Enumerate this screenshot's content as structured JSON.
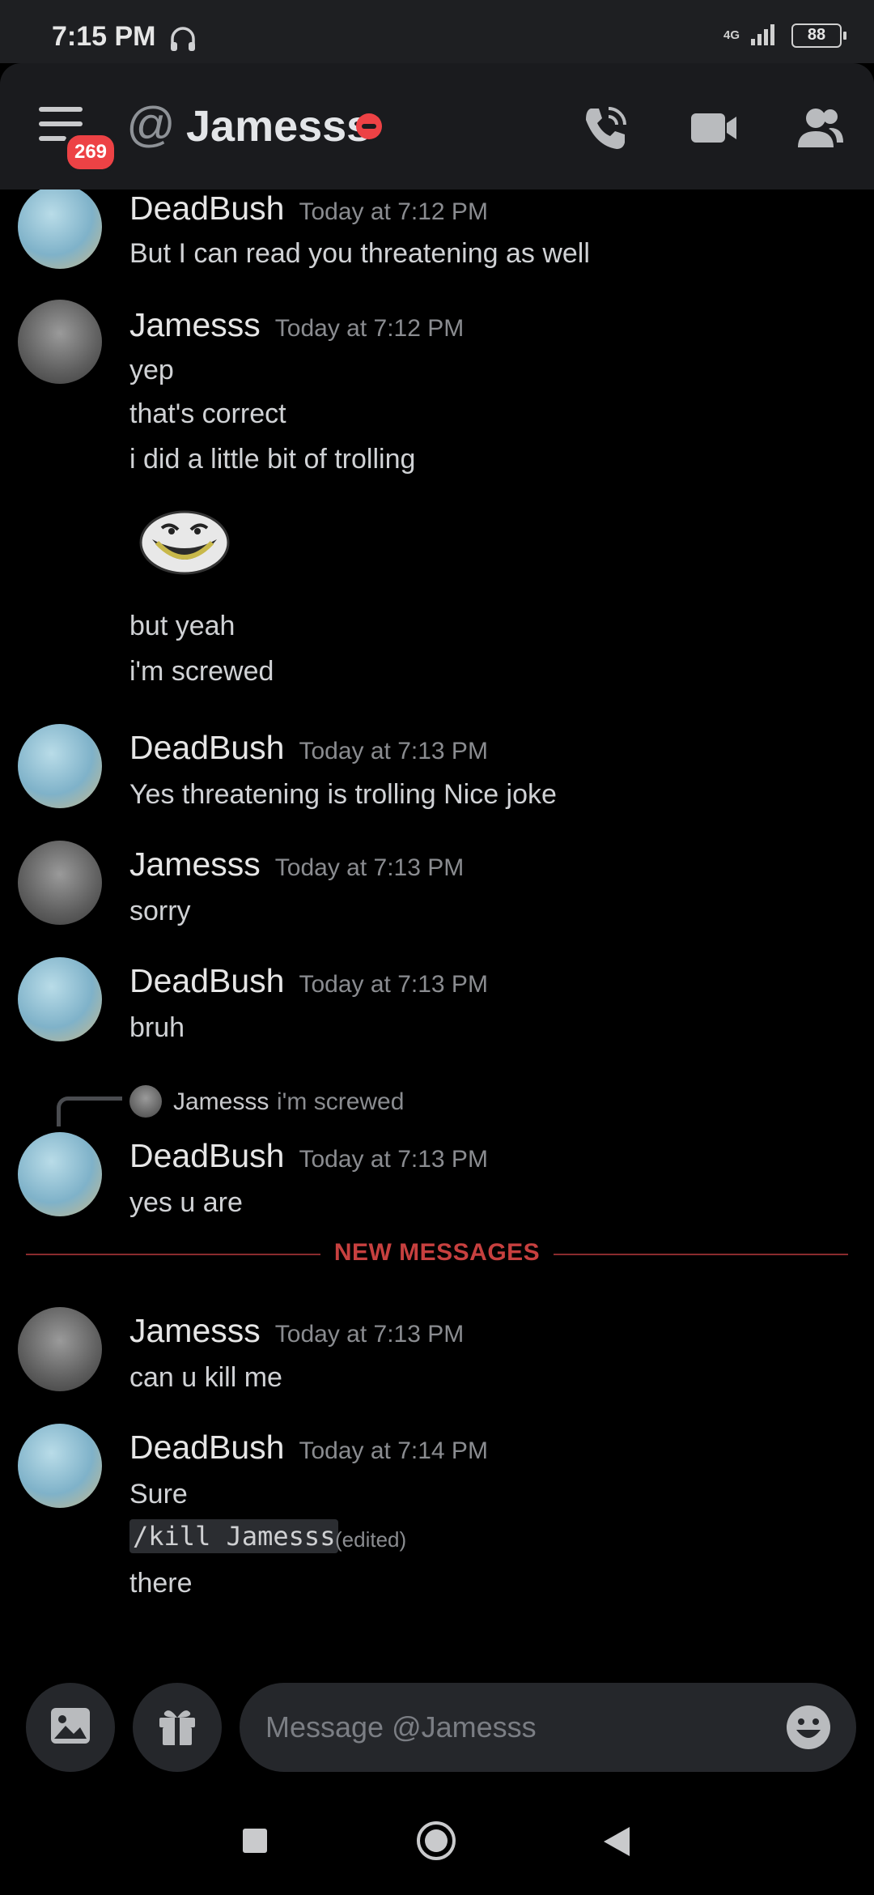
{
  "status_bar": {
    "time": "7:15 PM",
    "network": "4G",
    "battery": "88"
  },
  "header": {
    "notification_count": "269",
    "at_symbol": "@",
    "channel_name": "Jamesss"
  },
  "messages": [
    {
      "author": "DeadBush",
      "timestamp": "Today at 7:12 PM",
      "lines": [
        "But I can read you threatening as well"
      ]
    },
    {
      "author": "Jamesss",
      "timestamp": "Today at 7:12 PM",
      "lines": [
        "yep",
        "that's correct",
        "i did a little bit of trolling",
        "but yeah",
        "i'm screwed"
      ]
    },
    {
      "author": "DeadBush",
      "timestamp": "Today at 7:13 PM",
      "lines": [
        "Yes threatening is trolling Nice joke"
      ]
    },
    {
      "author": "Jamesss",
      "timestamp": "Today at 7:13 PM",
      "lines": [
        "sorry"
      ]
    },
    {
      "author": "DeadBush",
      "timestamp": "Today at 7:13 PM",
      "lines": [
        "bruh"
      ]
    },
    {
      "author": "DeadBush",
      "timestamp": "Today at 7:13 PM",
      "reply_to": {
        "author": "Jamesss",
        "text": "i'm screwed"
      },
      "lines": [
        "yes u are"
      ]
    },
    {
      "author": "Jamesss",
      "timestamp": "Today at 7:13 PM",
      "lines": [
        "can u kill me"
      ]
    },
    {
      "author": "DeadBush",
      "timestamp": "Today at 7:14 PM",
      "lines": [
        "Sure",
        "/kill Jamesss",
        "there"
      ],
      "edited_label": "(edited)"
    }
  ],
  "divider": {
    "label": "NEW MESSAGES"
  },
  "composer": {
    "placeholder": "Message @Jamesss"
  },
  "icons": {
    "menu": "hamburger-menu-icon",
    "at": "at-icon",
    "status": "do-not-disturb-icon",
    "call": "phone-call-icon",
    "video": "video-camera-icon",
    "members": "members-icon",
    "gallery": "image-gallery-icon",
    "gift": "gift-icon",
    "emoji": "emoji-icon",
    "trollface": "trollface-emoji"
  },
  "colors": {
    "accent_red": "#ed4245",
    "background": "#000000",
    "header": "#1a1b1e"
  }
}
